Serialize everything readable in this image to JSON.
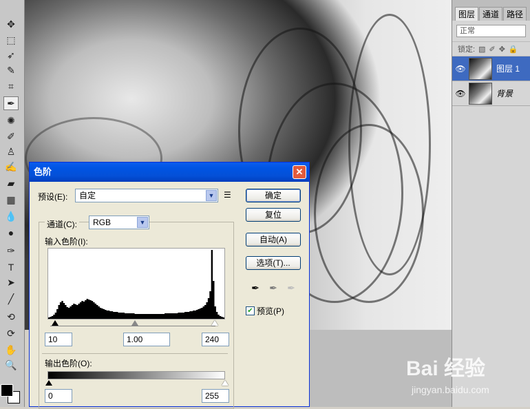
{
  "tools": [
    {
      "icon": "move-icon",
      "glyph": "✥"
    },
    {
      "icon": "marquee-icon",
      "glyph": "⬚"
    },
    {
      "icon": "lasso-icon",
      "glyph": "➶"
    },
    {
      "icon": "quick-select-icon",
      "glyph": "✎"
    },
    {
      "icon": "crop-icon",
      "glyph": "⌗"
    },
    {
      "icon": "eyedropper-icon",
      "glyph": "✒"
    },
    {
      "icon": "healing-icon",
      "glyph": "✺"
    },
    {
      "icon": "brush-icon",
      "glyph": "✐"
    },
    {
      "icon": "stamp-icon",
      "glyph": "♙"
    },
    {
      "icon": "history-brush-icon",
      "glyph": "✍"
    },
    {
      "icon": "eraser-icon",
      "glyph": "▰"
    },
    {
      "icon": "gradient-icon",
      "glyph": "▦"
    },
    {
      "icon": "blur-icon",
      "glyph": "💧"
    },
    {
      "icon": "dodge-icon",
      "glyph": "●"
    },
    {
      "icon": "pen-icon",
      "glyph": "✑"
    },
    {
      "icon": "type-icon",
      "glyph": "T"
    },
    {
      "icon": "path-select-icon",
      "glyph": "➤"
    },
    {
      "icon": "line-icon",
      "glyph": "╱"
    },
    {
      "icon": "3d-rotate-icon",
      "glyph": "⟲"
    },
    {
      "icon": "3d-orbit-icon",
      "glyph": "⟳"
    },
    {
      "icon": "hand-icon",
      "glyph": "✋"
    },
    {
      "icon": "zoom-icon",
      "glyph": "🔍"
    }
  ],
  "panel": {
    "tabs": [
      "图层",
      "通道",
      "路径"
    ],
    "blend_mode": "正常",
    "lock_label": "锁定:",
    "layers": [
      {
        "name": "图层 1",
        "selected": true
      },
      {
        "name": "背景",
        "selected": false
      }
    ]
  },
  "dialog": {
    "title": "色阶",
    "preset_label": "预设(E):",
    "preset_value": "自定",
    "channel_label": "通道(C):",
    "channel_value": "RGB",
    "input_levels_label": "输入色阶(I):",
    "input_black": "10",
    "input_gamma": "1.00",
    "input_white": "240",
    "output_levels_label": "输出色阶(O):",
    "output_black": "0",
    "output_white": "255",
    "buttons": {
      "ok": "确定",
      "reset": "复位",
      "auto": "自动(A)",
      "options": "选项(T)..."
    },
    "preview_label": "预览(P)",
    "preview_checked": true,
    "histogram": [
      2,
      3,
      4,
      6,
      9,
      14,
      20,
      24,
      26,
      23,
      20,
      17,
      16,
      18,
      20,
      22,
      21,
      20,
      22,
      24,
      26,
      25,
      27,
      29,
      28,
      27,
      26,
      24,
      22,
      20,
      18,
      16,
      15,
      14,
      13,
      12,
      12,
      11,
      11,
      10,
      10,
      10,
      9,
      9,
      9,
      9,
      8,
      8,
      8,
      8,
      8,
      8,
      7,
      7,
      7,
      7,
      7,
      7,
      7,
      7,
      7,
      7,
      7,
      7,
      7,
      7,
      7,
      7,
      7,
      7,
      8,
      8,
      8,
      8,
      8,
      8,
      8,
      8,
      9,
      9,
      9,
      9,
      10,
      10,
      10,
      11,
      11,
      12,
      12,
      13,
      14,
      15,
      16,
      18,
      20,
      24,
      30,
      40,
      100,
      55,
      18,
      10,
      6,
      4,
      3,
      2
    ]
  },
  "watermark": {
    "text": "Bai 经验",
    "url": "jingyan.baidu.com"
  }
}
